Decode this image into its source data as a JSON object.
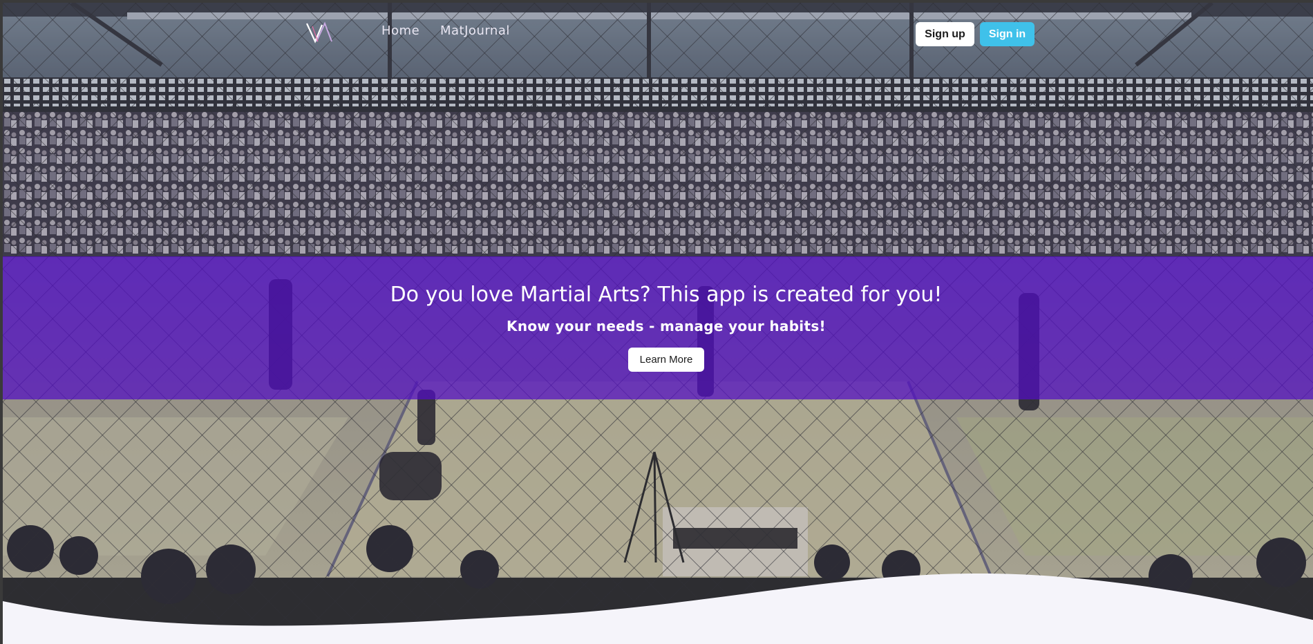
{
  "nav": {
    "logo_alt": "logo",
    "links": [
      "Home",
      "MatJournal"
    ],
    "signup_label": "Sign up",
    "signin_label": "Sign in"
  },
  "hero": {
    "title": "Do you love Martial Arts? This app is created for you!",
    "subtitle": "Know your needs - manage your habits!",
    "cta_label": "Learn More"
  },
  "colors": {
    "banner": "#520cc4",
    "signin": "#3fc1ea",
    "wave": "#f5f4fa"
  }
}
